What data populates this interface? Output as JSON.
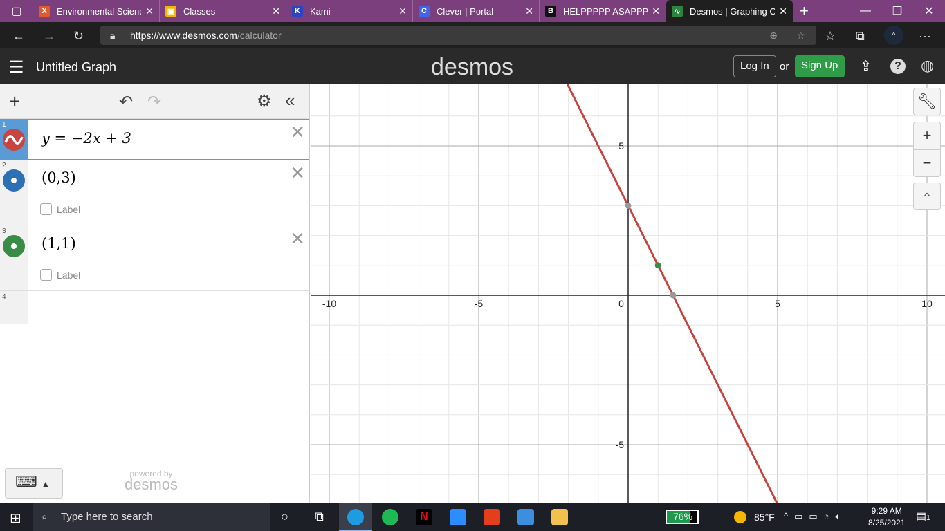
{
  "browser": {
    "tabs": [
      {
        "title": "Environmental Science",
        "color": "#e05a2a",
        "letter": "X"
      },
      {
        "title": "Classes",
        "color": "#f2b600",
        "letter": "▣"
      },
      {
        "title": "Kami",
        "color": "#2b44c4",
        "letter": "K"
      },
      {
        "title": "Clever | Portal",
        "color": "#4164e8",
        "letter": "C"
      },
      {
        "title": "HELPPPPP ASAPPPP P",
        "color": "#111111",
        "letter": "B"
      },
      {
        "title": "Desmos | Graphing Ca",
        "color": "#2e8540",
        "letter": "∿"
      }
    ],
    "url_host": "https://www.desmos.com",
    "url_path": "/calculator",
    "profile": "^"
  },
  "header": {
    "title": "Untitled Graph",
    "logo": "desmos",
    "login": "Log In",
    "or": "or",
    "signup": "Sign Up"
  },
  "expressions": [
    {
      "num": "1",
      "latex": "y = −2x + 3",
      "color": "#c74440"
    },
    {
      "num": "2",
      "latex": "(0,3)",
      "color": "#2d70b3",
      "label": "Label"
    },
    {
      "num": "3",
      "latex": "(1,1)",
      "color": "#388c46",
      "label": "Label"
    },
    {
      "num": "4"
    }
  ],
  "powered_by": "powered by",
  "powered_logo": "desmos",
  "graph": {
    "x_ticks": [
      "-10",
      "-5",
      "0",
      "5",
      "10"
    ],
    "y_ticks": [
      "5",
      "-5"
    ],
    "line": {
      "slope": -2,
      "intercept": 3,
      "color": "#c74440"
    },
    "points": [
      {
        "x": 0,
        "y": 3,
        "color": "#999999"
      },
      {
        "x": 1,
        "y": 1,
        "color": "#388c46"
      },
      {
        "x": 1.5,
        "y": 0,
        "color": "#999999"
      }
    ]
  },
  "taskbar": {
    "search": "Type here to search",
    "battery": "76%",
    "battery_level": 0.76,
    "weather": "85°F",
    "time": "9:29 AM",
    "date": "8/25/2021",
    "notifications": "1"
  }
}
